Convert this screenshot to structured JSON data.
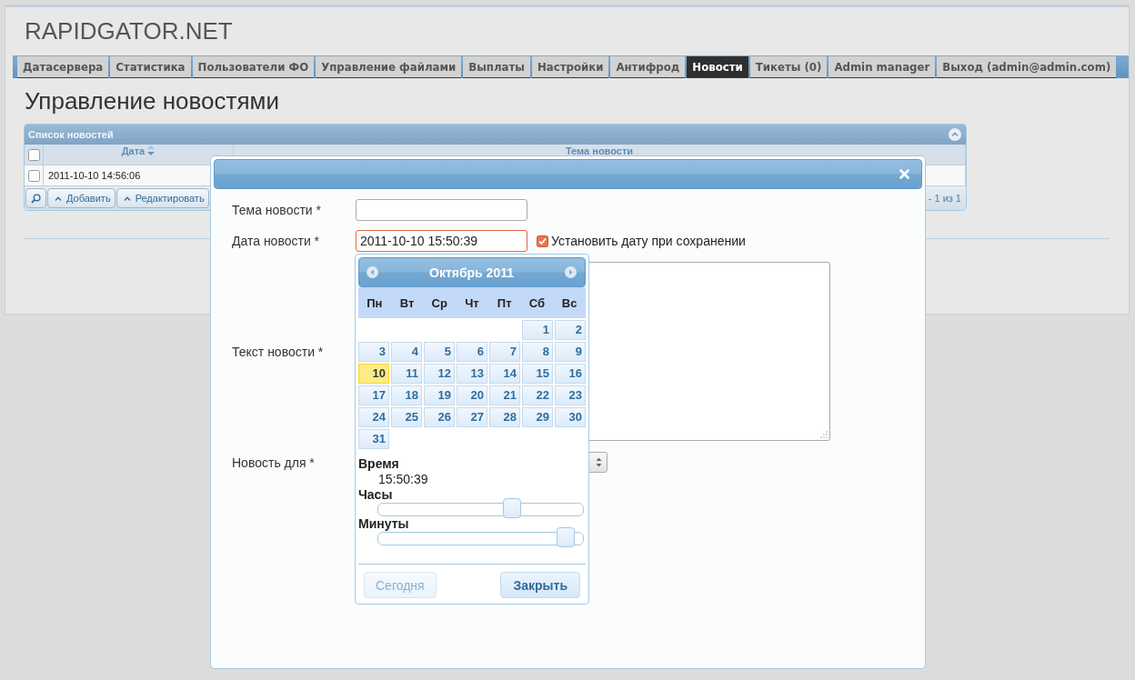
{
  "header": {
    "logo": "RAPIDGATOR.NET"
  },
  "nav": [
    {
      "label": "Датасервера",
      "selected": false
    },
    {
      "label": "Статистика",
      "selected": false
    },
    {
      "label": "Пользователи ФО",
      "selected": false
    },
    {
      "label": "Управление файлами",
      "selected": false
    },
    {
      "label": "Выплаты",
      "selected": false
    },
    {
      "label": "Настройки",
      "selected": false
    },
    {
      "label": "Антифрод",
      "selected": false
    },
    {
      "label": "Новости",
      "selected": true
    },
    {
      "label": "Тикеты (0)",
      "selected": false
    },
    {
      "label": "Admin manager",
      "selected": false
    },
    {
      "label": "Выход (admin@admin.com)",
      "selected": false
    }
  ],
  "page_title": "Управление новостями",
  "grid": {
    "title": "Список новостей",
    "select_all_checked": false,
    "columns": [
      {
        "label": "Дата",
        "sorted": true
      },
      {
        "label": "Тема новости",
        "sorted": false
      }
    ],
    "rows": [
      {
        "checked": false,
        "date": "2011-10-10 14:56:06"
      }
    ],
    "pager_buttons": [
      {
        "kind": "search"
      },
      {
        "kind": "labeled",
        "label": "Добавить"
      },
      {
        "kind": "labeled",
        "label": "Редактировать"
      }
    ],
    "pager_info": "- 1 из 1"
  },
  "dialog": {
    "fields": [
      {
        "kind": "text",
        "label": "Тема новости *",
        "focused": false
      },
      {
        "kind": "date",
        "label": "Дата новости *",
        "value": "2011-10-10 15:50:39",
        "focused": true,
        "option": {
          "label": "Установить дату при сохранении",
          "checked": true
        }
      },
      {
        "kind": "textarea",
        "label": "Текст новости *",
        "focused": false
      },
      {
        "kind": "select",
        "label": "Новость для *",
        "focused": false
      }
    ]
  },
  "datepicker": {
    "month": "Октябрь 2011",
    "weekdays": [
      "Пн",
      "Вт",
      "Ср",
      "Чт",
      "Пт",
      "Сб",
      "Вс"
    ],
    "weeks": [
      [
        {
          "day": "1",
          "selected": false
        },
        {
          "day": "2",
          "selected": false
        }
      ],
      [
        {
          "day": "3",
          "selected": false
        },
        {
          "day": "4",
          "selected": false
        },
        {
          "day": "5",
          "selected": false
        },
        {
          "day": "6",
          "selected": false
        },
        {
          "day": "7",
          "selected": false
        },
        {
          "day": "8",
          "selected": false
        },
        {
          "day": "9",
          "selected": false
        }
      ],
      [
        {
          "day": "10",
          "selected": true
        },
        {
          "day": "11",
          "selected": false
        },
        {
          "day": "12",
          "selected": false
        },
        {
          "day": "13",
          "selected": false
        },
        {
          "day": "14",
          "selected": false
        },
        {
          "day": "15",
          "selected": false
        },
        {
          "day": "16",
          "selected": false
        }
      ],
      [
        {
          "day": "17",
          "selected": false
        },
        {
          "day": "18",
          "selected": false
        },
        {
          "day": "19",
          "selected": false
        },
        {
          "day": "20",
          "selected": false
        },
        {
          "day": "21",
          "selected": false
        },
        {
          "day": "22",
          "selected": false
        },
        {
          "day": "23",
          "selected": false
        }
      ],
      [
        {
          "day": "24",
          "selected": false
        },
        {
          "day": "25",
          "selected": false
        },
        {
          "day": "26",
          "selected": false
        },
        {
          "day": "27",
          "selected": false
        },
        {
          "day": "28",
          "selected": false
        },
        {
          "day": "29",
          "selected": false
        },
        {
          "day": "30",
          "selected": false
        }
      ],
      [
        {
          "day": "31",
          "selected": false
        }
      ]
    ],
    "time_heading": "Время",
    "time": "15:50:39",
    "sliders": [
      {
        "label": "Часы",
        "level": 0.65
      },
      {
        "label": "Минуты",
        "level": 0.91
      }
    ],
    "buttons": [
      {
        "label": "Сегодня",
        "primary": false
      },
      {
        "label": "Закрыть",
        "primary": true
      }
    ]
  }
}
